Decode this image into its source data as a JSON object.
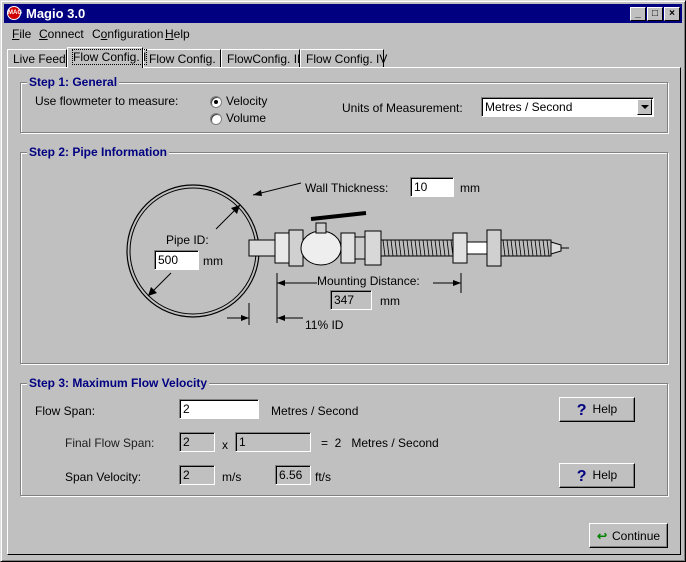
{
  "window": {
    "title": "Magio 3.0",
    "icon": "magio-logo-icon",
    "icon_text": "MAG"
  },
  "titlebar_buttons": {
    "minimize": "_",
    "maximize": "□",
    "close": "×"
  },
  "menu": [
    {
      "label": "File",
      "accel": "F",
      "rest": "ile"
    },
    {
      "label": "Connect",
      "accel": "C",
      "rest": "onnect"
    },
    {
      "label": "Configuration",
      "accel": "",
      "pre": "C",
      "rest": "onfiguration",
      "u": "o"
    },
    {
      "label": "Help",
      "accel": "H",
      "rest": "elp"
    }
  ],
  "tabs": [
    "Live Feed",
    "Flow Config. I",
    "Flow Config. II",
    "FlowConfig. III",
    "Flow Config. IV"
  ],
  "active_tab": 1,
  "step1": {
    "title": "Step 1: General",
    "measure_label": "Use flowmeter to measure:",
    "options": [
      "Velocity",
      "Volume"
    ],
    "selected": "Velocity",
    "units_label": "Units of Measurement:",
    "units_value": "Metres / Second"
  },
  "step2": {
    "title": "Step 2: Pipe Information",
    "wall_thickness_label": "Wall Thickness:",
    "wall_thickness_value": "10",
    "wall_unit": "mm",
    "pipe_id_label": "Pipe ID:",
    "pipe_id_value": "500",
    "pipe_unit": "mm",
    "mounting_label": "Mounting Distance:",
    "mounting_value": "347",
    "mounting_unit": "mm",
    "id_pct_label": "11% ID"
  },
  "step3": {
    "title": "Step 3: Maximum Flow Velocity",
    "flow_span_label": "Flow Span:",
    "flow_span_value": "2",
    "flow_span_unit": "Metres / Second",
    "help_label": "Help",
    "final_label": "Final Flow Span:",
    "final_a": "2",
    "times": "x",
    "final_b": "1",
    "final_result": "=  2   Metres / Second",
    "span_label": "Span Velocity:",
    "span_ms": "2",
    "span_ms_unit": "m/s",
    "span_fts": "6.56",
    "span_fts_unit": "ft/s"
  },
  "continue_label": "Continue",
  "colors": {
    "titlebar": "#000080",
    "face": "#c0c0c0",
    "group_title": "#000080",
    "continue_arrow": "#008000"
  }
}
